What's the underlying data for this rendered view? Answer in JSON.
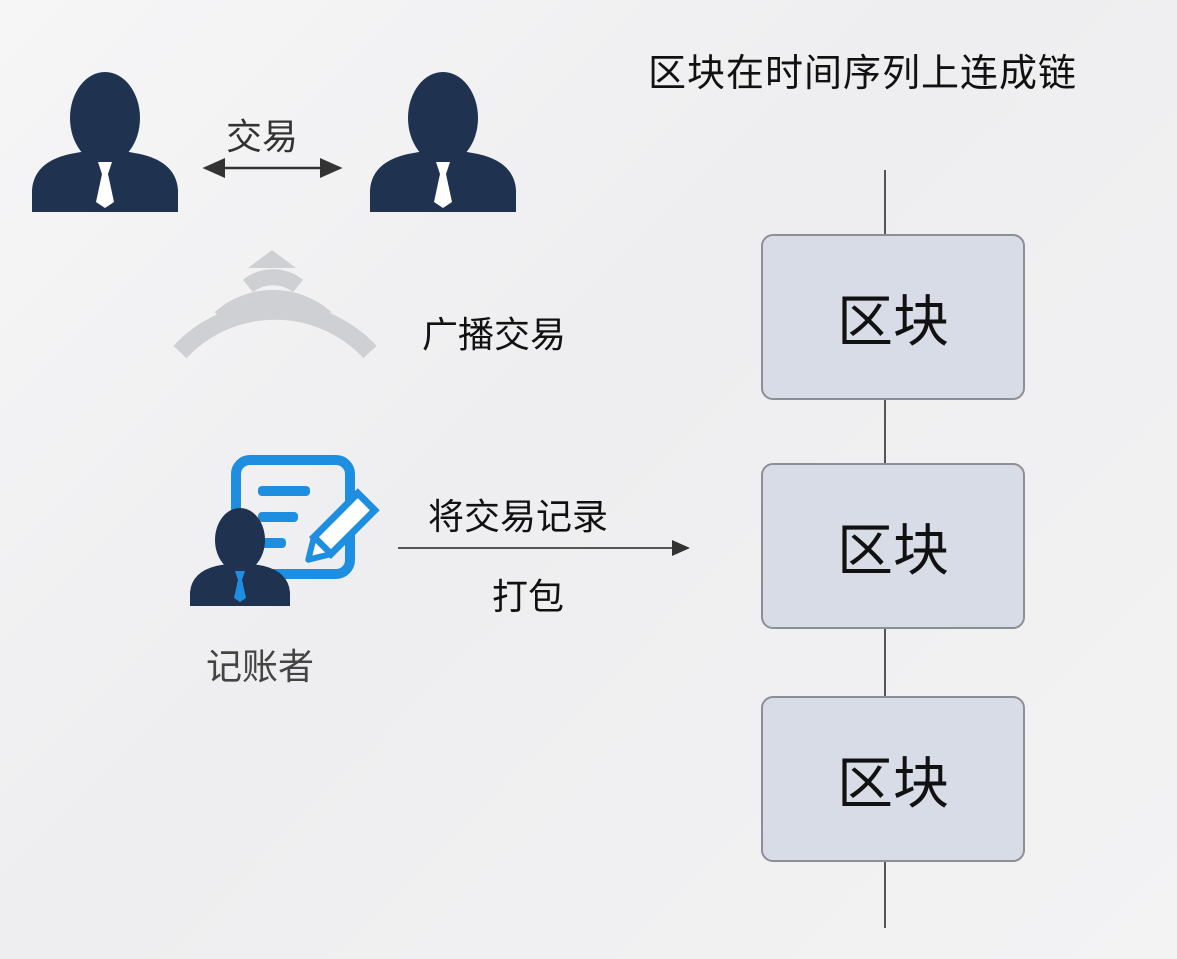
{
  "title": "区块在时间序列上连成链",
  "labels": {
    "trade": "交易",
    "broadcast": "广播交易",
    "record": "将交易记录",
    "pack": "打包",
    "bookkeeper": "记账者"
  },
  "blocks": [
    {
      "label": "区块"
    },
    {
      "label": "区块"
    },
    {
      "label": "区块"
    }
  ],
  "icons": {
    "person": "person-icon",
    "broadcast": "broadcast-waves-icon",
    "document_edit": "document-edit-icon"
  },
  "colors": {
    "person": "#1f3350",
    "accent_blue": "#1e8fe0",
    "waves": "#cfd0d3",
    "block_fill": "#d8dce6",
    "block_border": "#8d8f96",
    "line": "#555555"
  }
}
